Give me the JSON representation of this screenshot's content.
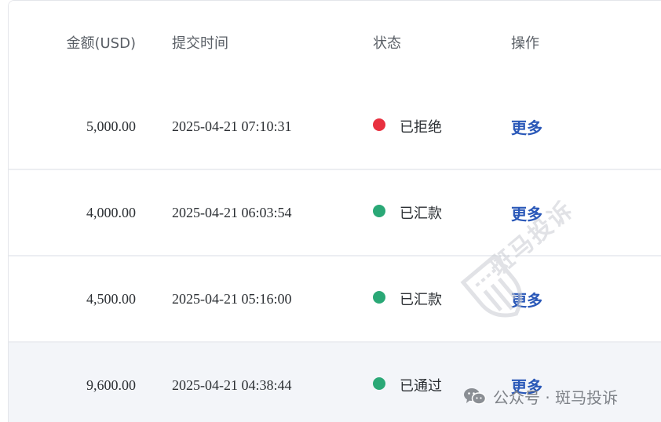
{
  "table": {
    "headers": {
      "amount": "金额(USD)",
      "time": "提交时间",
      "status": "状态",
      "action": "操作"
    },
    "rows": [
      {
        "amount": "5,000.00",
        "time": "2025-04-21 07:10:31",
        "status": "已拒绝",
        "status_color": "#e8303f",
        "action": "更多"
      },
      {
        "amount": "4,000.00",
        "time": "2025-04-21 06:03:54",
        "status": "已汇款",
        "status_color": "#2aa876",
        "action": "更多"
      },
      {
        "amount": "4,500.00",
        "time": "2025-04-21 05:16:00",
        "status": "已汇款",
        "status_color": "#2aa876",
        "action": "更多"
      },
      {
        "amount": "9,600.00",
        "time": "2025-04-21 04:38:44",
        "status": "已通过",
        "status_color": "#2aa876",
        "action": "更多"
      }
    ]
  },
  "watermark": {
    "text": "斑马投诉"
  },
  "footer": {
    "icon": "wechat-icon",
    "label": "公众号 · 斑马投诉"
  },
  "colors": {
    "link": "#2a58b8",
    "rejected": "#e8303f",
    "approved": "#2aa876",
    "highlight_row": "#f3f5f9"
  }
}
